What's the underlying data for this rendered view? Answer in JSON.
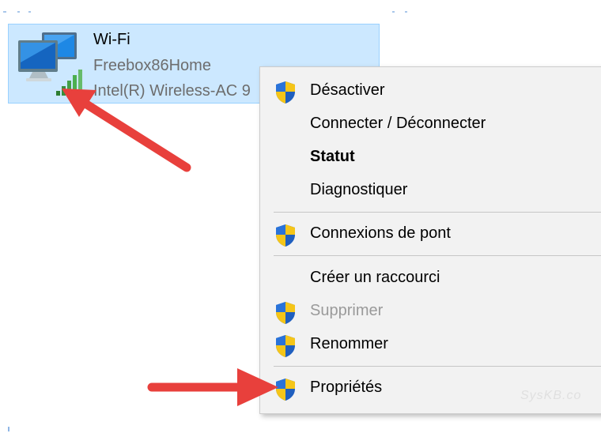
{
  "adapter": {
    "name": "Wi-Fi",
    "ssid": "Freebox86Home",
    "device": "Intel(R) Wireless-AC 9",
    "icon": "network-adapter-icon"
  },
  "context_menu": {
    "items": [
      {
        "label": "Désactiver",
        "icon": "uac-shield-icon",
        "enabled": true
      },
      {
        "label": "Connecter / Déconnecter",
        "icon": null,
        "enabled": true
      },
      {
        "label": "Statut",
        "icon": null,
        "enabled": true,
        "bold": true
      },
      {
        "label": "Diagnostiquer",
        "icon": null,
        "enabled": true
      },
      {
        "label": "Connexions de pont",
        "icon": "uac-shield-icon",
        "enabled": true
      },
      {
        "label": "Créer un raccourci",
        "icon": null,
        "enabled": true
      },
      {
        "label": "Supprimer",
        "icon": "uac-shield-icon",
        "enabled": false
      },
      {
        "label": "Renommer",
        "icon": "uac-shield-icon",
        "enabled": true
      },
      {
        "label": "Propriétés",
        "icon": "uac-shield-icon",
        "enabled": true,
        "highlighted": true
      }
    ]
  },
  "watermark": "SysKB.co",
  "colors": {
    "selection_bg": "#cce8ff",
    "menu_bg": "#f2f2f2",
    "arrow": "#e8403c",
    "disabled_text": "#9a9a9a"
  }
}
